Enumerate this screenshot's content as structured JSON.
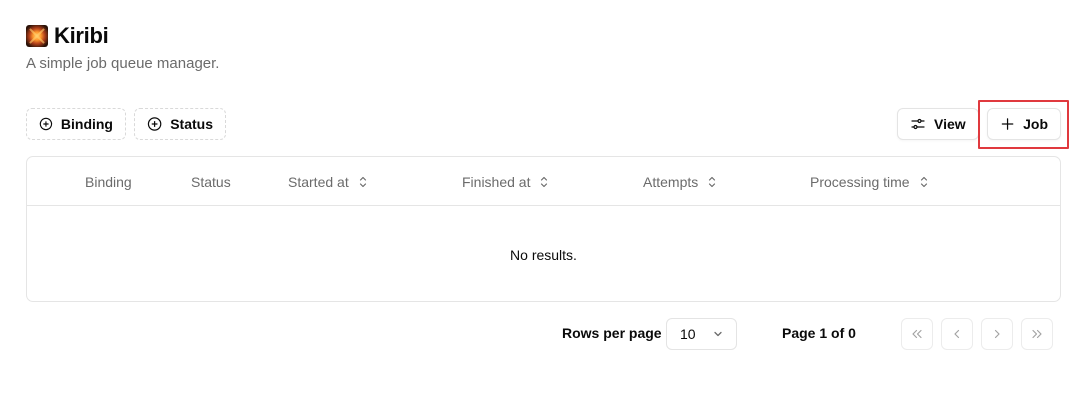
{
  "app": {
    "title": "Kiribi",
    "subtitle": "A simple job queue manager.",
    "logo_icon": "sparkler-icon"
  },
  "toolbar": {
    "filters": [
      {
        "label": "Binding",
        "icon": "plus-circle-icon"
      },
      {
        "label": "Status",
        "icon": "plus-circle-icon"
      }
    ],
    "view_label": "View",
    "view_icon": "sliders-icon",
    "add_job_label": "Job",
    "add_job_icon": "plus-icon",
    "highlight_color": "#e0393e"
  },
  "table": {
    "columns": [
      {
        "label": "Binding",
        "sortable": false
      },
      {
        "label": "Status",
        "sortable": false
      },
      {
        "label": "Started at",
        "sortable": true
      },
      {
        "label": "Finished at",
        "sortable": true
      },
      {
        "label": "Attempts",
        "sortable": true
      },
      {
        "label": "Processing time",
        "sortable": true
      }
    ],
    "rows": [],
    "empty_text": "No results."
  },
  "pagination": {
    "rows_per_page_label": "Rows per page",
    "rows_per_page_value": "10",
    "page_info": "Page 1 of 0",
    "buttons": [
      "first-page",
      "previous-page",
      "next-page",
      "last-page"
    ]
  }
}
